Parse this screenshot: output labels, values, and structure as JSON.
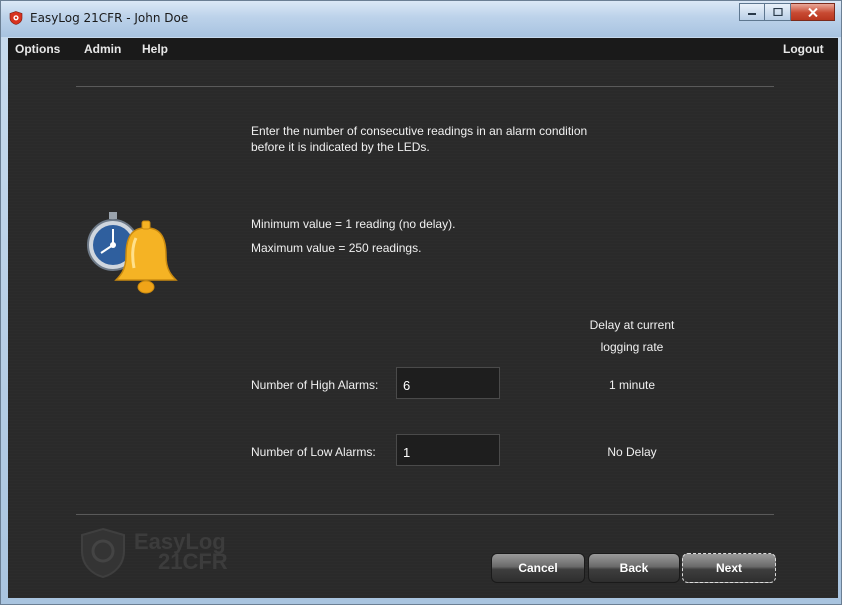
{
  "window": {
    "title": "EasyLog 21CFR - John Doe"
  },
  "menu": {
    "options": "Options",
    "admin": "Admin",
    "help": "Help",
    "logout": "Logout"
  },
  "instructions": {
    "line1": "Enter the number of consecutive readings in an alarm condition",
    "line2": "before it is indicated by the LEDs.",
    "min": "Minimum value = 1 reading (no delay).",
    "max": "Maximum value = 250 readings."
  },
  "delay_header": {
    "line1": "Delay at current",
    "line2": "logging rate"
  },
  "high_alarms": {
    "label": "Number of High Alarms:",
    "value": "6",
    "delay": "1 minute"
  },
  "low_alarms": {
    "label": "Number of Low Alarms:",
    "value": "1",
    "delay": "No Delay"
  },
  "logo": {
    "line1": "EasyLog",
    "line2": "21CFR"
  },
  "buttons": {
    "cancel": "Cancel",
    "back": "Back",
    "next": "Next"
  },
  "icons": {
    "app": "app-logo-icon",
    "illustration": "stopwatch-bell-icon"
  },
  "colors": {
    "background": "#2a2a2a",
    "menubar": "#1a1a1a",
    "bell": "#f5b324",
    "stopwatch": "#2f5f9e",
    "close": "#c84a32"
  }
}
